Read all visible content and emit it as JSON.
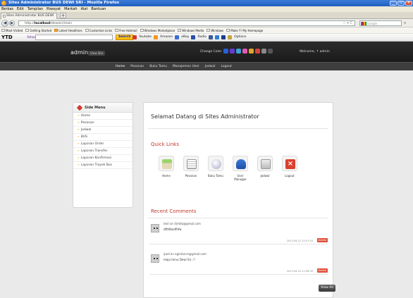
{
  "window": {
    "title": "Sites Administrator BUS DEWI SRI - Mozilla Firefox"
  },
  "menubar": [
    "Berkas",
    "Edit",
    "Tampilan",
    "Riwayat",
    "Markah",
    "Alat",
    "Bantuan"
  ],
  "browser": {
    "tab_label": "Sites Administrator BUS DEWI SRI",
    "new_tab": "+",
    "url_prefix": "http://",
    "url_host": "localhost",
    "url_path": "/dewisri/main",
    "search_placeholder": "Google"
  },
  "bookmarks": [
    "Most Visited",
    "Getting Started",
    "Latest Headlines",
    "Customize Links",
    "Free Hotmail",
    "Windows Marketplace",
    "Windows Media",
    "Windows",
    "Make Y! My Homepage"
  ],
  "yahoo_toolbar": {
    "brand": "YTD",
    "yahoo": "Yahoo!",
    "search_btn": "Search",
    "tools": [
      "Youtube",
      "Amazon",
      "eBay",
      "Radio",
      "Options"
    ]
  },
  "site": {
    "brand": "admin",
    "view_site": "View Site",
    "change_color": "Change Color",
    "swatch_colors": [
      "#2b5fd4",
      "#6a3ad4",
      "#3aa3d4",
      "#e05ab3",
      "#e0a52a",
      "#d4453a",
      "#8a8a8a",
      "#555555"
    ],
    "welcome": "Welcome, ↑ admin"
  },
  "nav": [
    "Home",
    "Pesanan",
    "Buku Tamu",
    "Manajemen User",
    "Jadwal",
    "Logout"
  ],
  "sidemenu": {
    "title": "Side Menu",
    "items": [
      "Home",
      "Pesanan",
      "Jadwal",
      "BUS",
      "Laporan Order",
      "Laporan Transfer",
      "Laporan Konfirmasi",
      "Laporan Trayek Bus"
    ]
  },
  "main": {
    "title": "Selamat Datang di Sites Administrator",
    "quicklinks_title": "Quick Links",
    "quicklinks": [
      {
        "label": "Home",
        "icon": "home-icon"
      },
      {
        "label": "Pesanan",
        "icon": "document-icon"
      },
      {
        "label": "Buku Tamu",
        "icon": "speech-bubble-icon"
      },
      {
        "label": "User Manager",
        "icon": "users-icon"
      },
      {
        "label": "Jadwal",
        "icon": "inbox-icon"
      },
      {
        "label": "Logout",
        "icon": "close-icon"
      }
    ],
    "comments_title": "Recent Comments",
    "comments": [
      {
        "email": "test on dsrtdo@gmail.com",
        "text": "dfthfbedfhfw",
        "time": "2013-06-22 20:47:44",
        "delete": "Delete"
      },
      {
        "email": "ipod on egirdance@gmail.com",
        "text": "maju terus Dewi Sri..!!",
        "time": "2013-06-22 21:08:39",
        "delete": "Delete"
      }
    ],
    "view_all": "View All"
  }
}
